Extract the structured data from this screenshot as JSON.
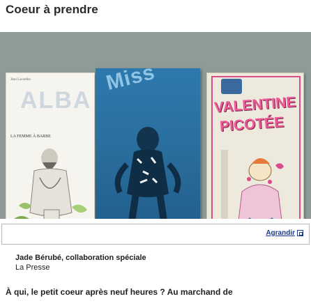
{
  "article": {
    "title": "Coeur à prendre",
    "enlarge_label": "Agrandir",
    "byline": "Jade Bérubé, collaboration spéciale",
    "source": "La Presse",
    "lead": "À qui, le petit coeur après neuf heures ? Au marchand de"
  },
  "photo": {
    "book1": {
      "author": "Jean Lacombe",
      "logo": "ALBA",
      "subtitle": "LA FEMME À BARBE"
    },
    "book2": {
      "title": "Miss"
    },
    "book3": {
      "title_line1": "VALENTINE",
      "title_line2": "PICOTÉE"
    }
  },
  "colors": {
    "link": "#1a3a8c",
    "book2_blue": "#2a6f9f",
    "book3_pink": "#ec5a97"
  },
  "icons": {
    "enlarge": "enlarge-icon"
  }
}
